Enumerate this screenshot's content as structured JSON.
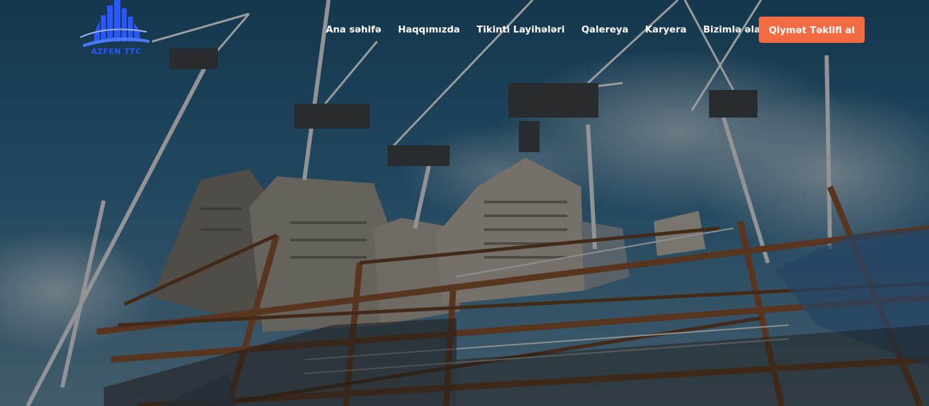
{
  "brand": {
    "logo_text": "AZFEN TTC",
    "logo_color": "#2a56ff"
  },
  "nav": {
    "items": [
      {
        "label": "Ana səhifə"
      },
      {
        "label": "Haqqımızda"
      },
      {
        "label": "Tikinti Layihələri"
      },
      {
        "label": "Qalereya"
      },
      {
        "label": "Karyera"
      },
      {
        "label": "Bizimlə əlaqə"
      }
    ]
  },
  "cta": {
    "label": "Qiymət Təklifi al",
    "color": "#f26b42"
  },
  "hero": {
    "image": "construction-site-with-cranes"
  }
}
